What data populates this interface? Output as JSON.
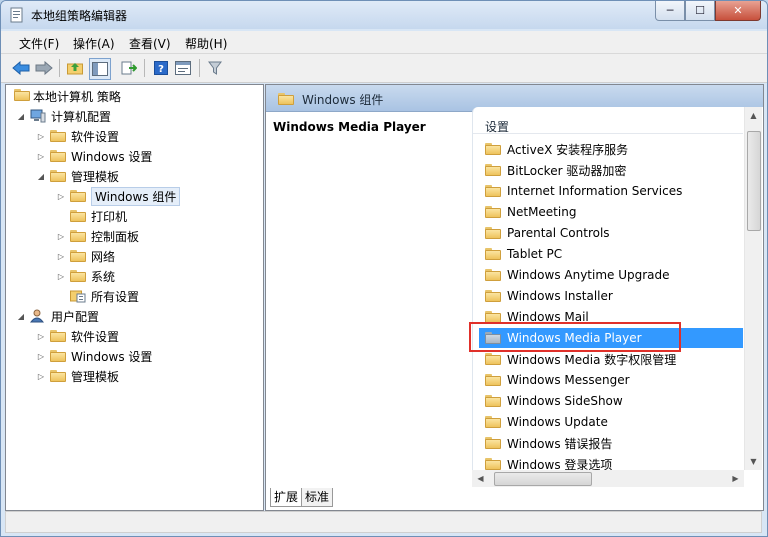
{
  "window": {
    "title": "本地组策略编辑器",
    "min": "─",
    "max": "☐",
    "close": "✕"
  },
  "menu": [
    {
      "label": "文件(F)"
    },
    {
      "label": "操作(A)"
    },
    {
      "label": "查看(V)"
    },
    {
      "label": "帮助(H)"
    }
  ],
  "tree": {
    "root": "本地计算机 策略",
    "computer": "计算机配置",
    "c_software": "软件设置",
    "c_windows": "Windows 设置",
    "c_admin": "管理模板",
    "c_components": "Windows 组件",
    "c_printers": "打印机",
    "c_control": "控制面板",
    "c_network": "网络",
    "c_system": "系统",
    "c_all": "所有设置",
    "user": "用户配置",
    "u_software": "软件设置",
    "u_windows": "Windows 设置",
    "u_admin": "管理模板"
  },
  "right": {
    "header": "Windows 组件",
    "description_title": "Windows Media Player",
    "column_header": "设置",
    "items": [
      "ActiveX 安装程序服务",
      "BitLocker 驱动器加密",
      "Internet Information Services",
      "NetMeeting",
      "Parental Controls",
      "Tablet PC",
      "Windows Anytime Upgrade",
      "Windows Installer",
      "Windows Mail",
      "Windows Media Player",
      "Windows Media 数字权限管理",
      "Windows Messenger",
      "Windows SideShow",
      "Windows Update",
      "Windows 错误报告",
      "Windows 登录选项"
    ],
    "selected_index": 9
  },
  "tabs": [
    "扩展",
    "标准"
  ],
  "colors": {
    "selection": "#3399ff",
    "highlight_box": "#e0302a"
  }
}
